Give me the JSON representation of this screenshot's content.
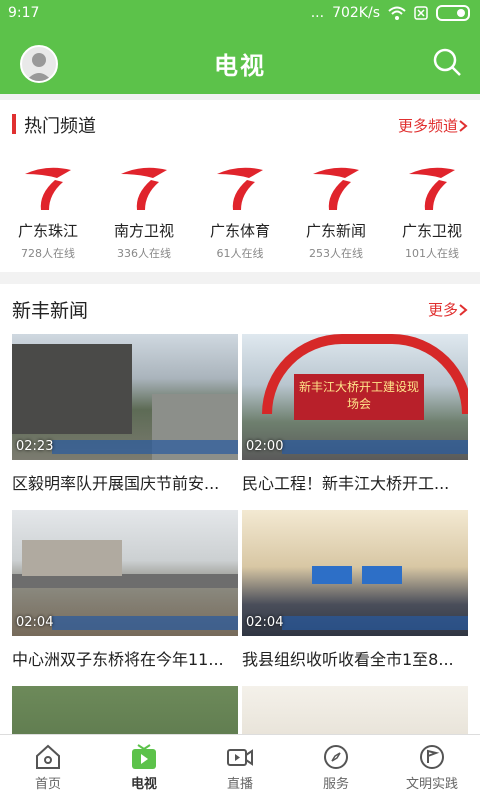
{
  "status": {
    "time": "9:17",
    "speed": "702K/s",
    "signal": "..."
  },
  "header": {
    "title": "电视"
  },
  "hot": {
    "title": "热门频道",
    "more": "更多频道"
  },
  "channels": [
    {
      "name": "广东珠江",
      "count": "728人在线"
    },
    {
      "name": "南方卫视",
      "count": "336人在线"
    },
    {
      "name": "广东体育",
      "count": "61人在线"
    },
    {
      "name": "广东新闻",
      "count": "253人在线"
    },
    {
      "name": "广东卫视",
      "count": "101人在线"
    }
  ],
  "news": {
    "title": "新丰新闻",
    "more": "更多",
    "items": [
      {
        "duration": "02:23",
        "headline": "区毅明率队开展国庆节前安..."
      },
      {
        "duration": "02:00",
        "headline": "民心工程！新丰江大桥开工...",
        "banner": "新丰江大桥开工建设现场会"
      },
      {
        "duration": "02:04",
        "headline": "中心洲双子东桥将在今年11..."
      },
      {
        "duration": "02:04",
        "headline": "我县组织收听收看全市1至8..."
      }
    ]
  },
  "tabs": [
    {
      "label": "首页"
    },
    {
      "label": "电视"
    },
    {
      "label": "直播"
    },
    {
      "label": "服务"
    },
    {
      "label": "文明实践"
    }
  ],
  "colors": {
    "green": "#5cc24a",
    "red": "#e03030"
  }
}
